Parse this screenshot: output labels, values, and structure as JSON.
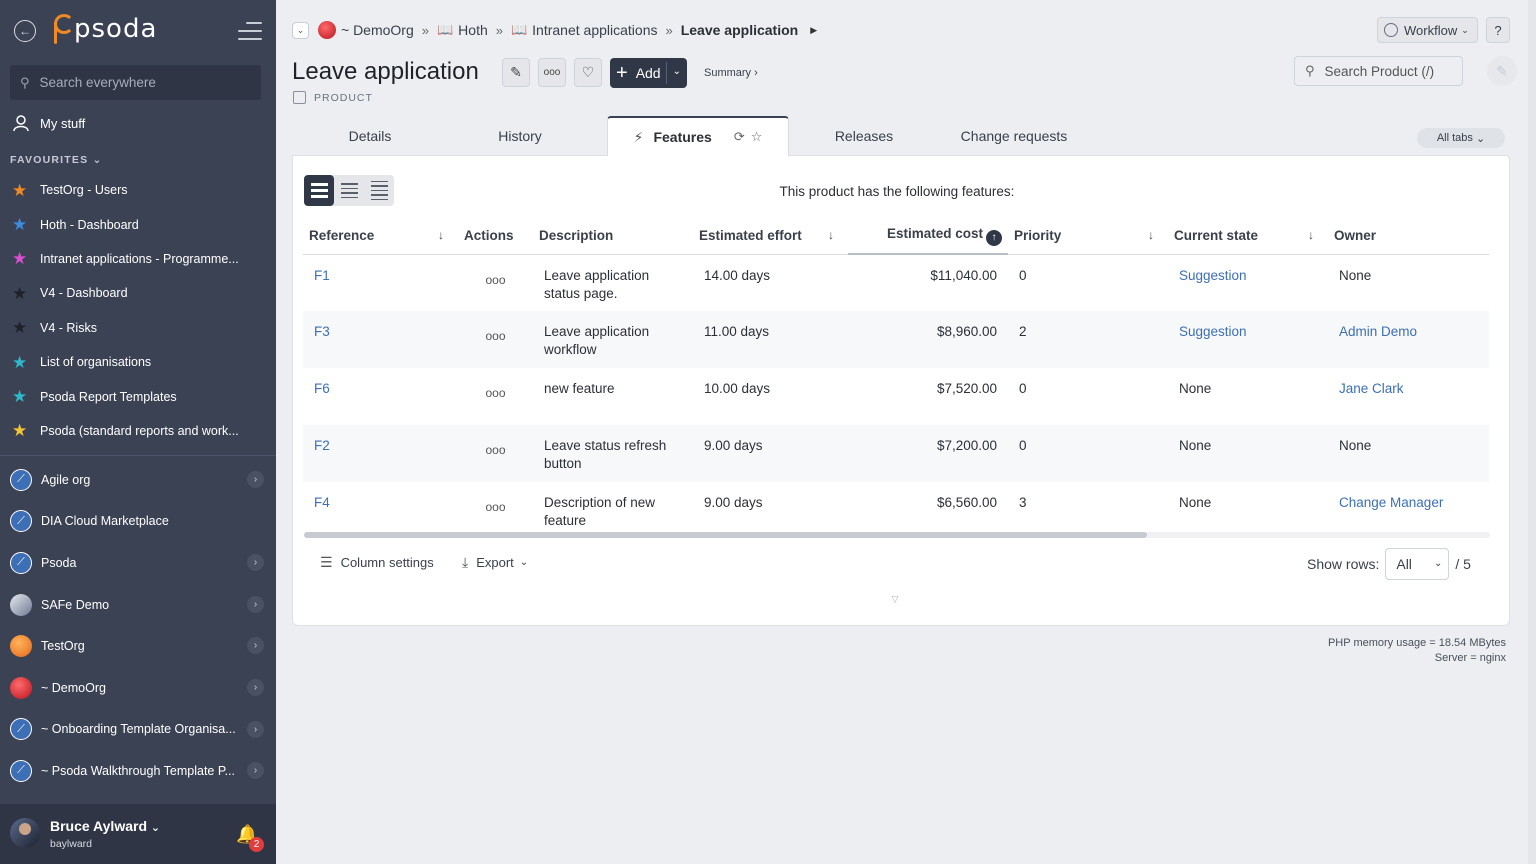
{
  "sidebar": {
    "logo_text": "psoda",
    "search_placeholder": "Search everywhere",
    "my_stuff": "My stuff",
    "favourites_heading": "FAVOURITES",
    "favourites": [
      {
        "label": "TestOrg - Users",
        "color": "#f08a24"
      },
      {
        "label": "Hoth - Dashboard",
        "color": "#3d8be0"
      },
      {
        "label": "Intranet applications - Programme...",
        "color": "#d84fd1"
      },
      {
        "label": "V4 - Dashboard",
        "color": "#1f2229"
      },
      {
        "label": "V4 - Risks",
        "color": "#1f2229"
      },
      {
        "label": "List of organisations",
        "color": "#2fb8c9"
      },
      {
        "label": "Psoda Report Templates",
        "color": "#2fb8c9"
      },
      {
        "label": "Psoda (standard reports and work...",
        "color": "#f3c434"
      }
    ],
    "orgs": [
      {
        "label": "Agile org",
        "icon": "compass-icon",
        "chevron": true
      },
      {
        "label": "DIA Cloud Marketplace",
        "icon": "compass-icon",
        "chevron": false
      },
      {
        "label": "Psoda",
        "icon": "compass-icon",
        "chevron": true
      },
      {
        "label": "SAFe Demo",
        "icon": "safe-logo-icon",
        "chevron": true
      },
      {
        "label": "TestOrg",
        "icon": "orange-orb-icon",
        "chevron": true
      },
      {
        "label": "~ DemoOrg",
        "icon": "red-orb-icon",
        "chevron": true
      },
      {
        "label": "~ Onboarding Template Organisa...",
        "icon": "compass-icon",
        "chevron": true
      },
      {
        "label": "~ Psoda Walkthrough Template P...",
        "icon": "compass-icon",
        "chevron": true
      }
    ],
    "user": {
      "name": "Bruce Aylward",
      "login": "baylward",
      "notifications": "2"
    }
  },
  "breadcrumb": {
    "org": "~ DemoOrg",
    "items": [
      "Hoth",
      "Intranet applications"
    ],
    "current": "Leave application"
  },
  "header": {
    "title": "Leave application",
    "type": "PRODUCT",
    "add_label": "Add",
    "summary_label": "Summary ›",
    "workflow_label": "Workflow",
    "help_label": "?",
    "search_placeholder": "Search Product (/)"
  },
  "tabs": {
    "items": [
      "Details",
      "History",
      "Features",
      "Releases",
      "Change requests"
    ],
    "active": "Features",
    "all_tabs": "All tabs"
  },
  "features": {
    "caption": "This product has the following features:",
    "columns": [
      "Reference",
      "Actions",
      "Description",
      "Estimated effort",
      "Estimated cost",
      "Priority",
      "Current state",
      "Owner"
    ],
    "rows": [
      {
        "ref": "F1",
        "actions": "ooo",
        "desc": "Leave application status page.",
        "effort": "14.00 days",
        "cost": "$11,040.00",
        "priority": "0",
        "state": "Suggestion",
        "state_link": true,
        "owner": "None",
        "owner_link": false
      },
      {
        "ref": "F3",
        "actions": "ooo",
        "desc": "Leave application workflow",
        "effort": "11.00 days",
        "cost": "$8,960.00",
        "priority": "2",
        "state": "Suggestion",
        "state_link": true,
        "owner": "Admin Demo",
        "owner_link": true
      },
      {
        "ref": "F6",
        "actions": "ooo",
        "desc": "new feature",
        "effort": "10.00 days",
        "cost": "$7,520.00",
        "priority": "0",
        "state": "None",
        "state_link": false,
        "owner": "Jane Clark",
        "owner_link": true
      },
      {
        "ref": "F2",
        "actions": "ooo",
        "desc": "Leave status refresh button",
        "effort": "9.00 days",
        "cost": "$7,200.00",
        "priority": "0",
        "state": "None",
        "state_link": false,
        "owner": "None",
        "owner_link": false
      },
      {
        "ref": "F4",
        "actions": "ooo",
        "desc": "Description of new feature",
        "effort": "9.00 days",
        "cost": "$6,560.00",
        "priority": "3",
        "state": "None",
        "state_link": false,
        "owner": "Change Manager",
        "owner_link": true
      }
    ],
    "column_settings": "Column settings",
    "export": "Export",
    "show_rows_label": "Show rows:",
    "show_rows_value": "All",
    "total": "/ 5"
  },
  "footer": {
    "memory": "PHP memory usage = 18.54 MBytes",
    "server": "Server = nginx"
  },
  "colors": {
    "sidebar": "#3b4254",
    "accent_dark": "#303848",
    "link": "#3c6fb5"
  }
}
